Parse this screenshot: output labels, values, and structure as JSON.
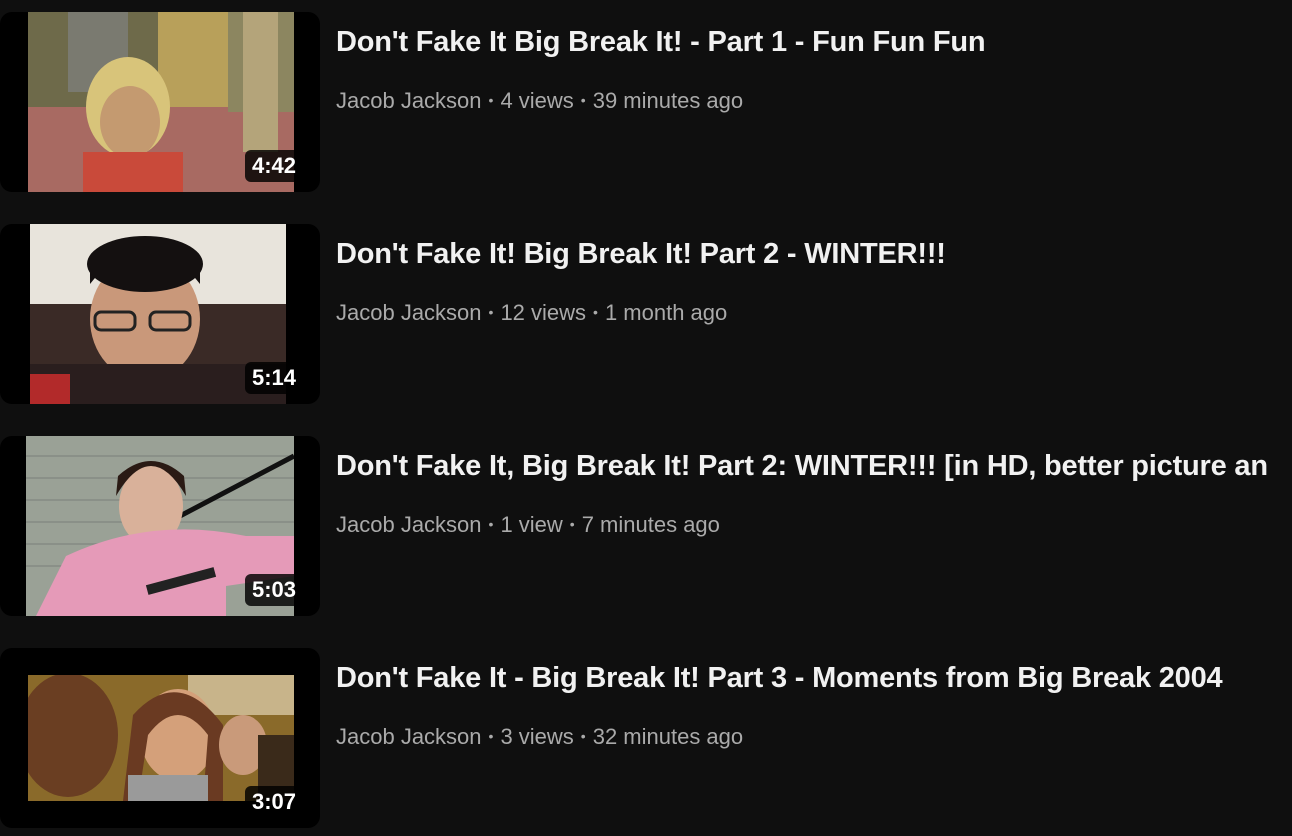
{
  "videos": [
    {
      "title": "Don't Fake It Big Break It! - Part 1 - Fun Fun Fun",
      "channel": "Jacob Jackson",
      "views": "4 views",
      "age": "39 minutes ago",
      "duration": "4:42"
    },
    {
      "title": "Don't Fake It! Big Break It! Part 2 - WINTER!!!",
      "channel": "Jacob Jackson",
      "views": "12 views",
      "age": "1 month ago",
      "duration": "5:14"
    },
    {
      "title": "Don't Fake It, Big Break It! Part 2: WINTER!!! [in HD, better picture an",
      "channel": "Jacob Jackson",
      "views": "1 view",
      "age": "7 minutes ago",
      "duration": "5:03"
    },
    {
      "title": "Don't Fake It - Big Break It! Part 3 - Moments from Big Break 2004",
      "channel": "Jacob Jackson",
      "views": "3 views",
      "age": "32 minutes ago",
      "duration": "3:07"
    }
  ],
  "separator": "•"
}
